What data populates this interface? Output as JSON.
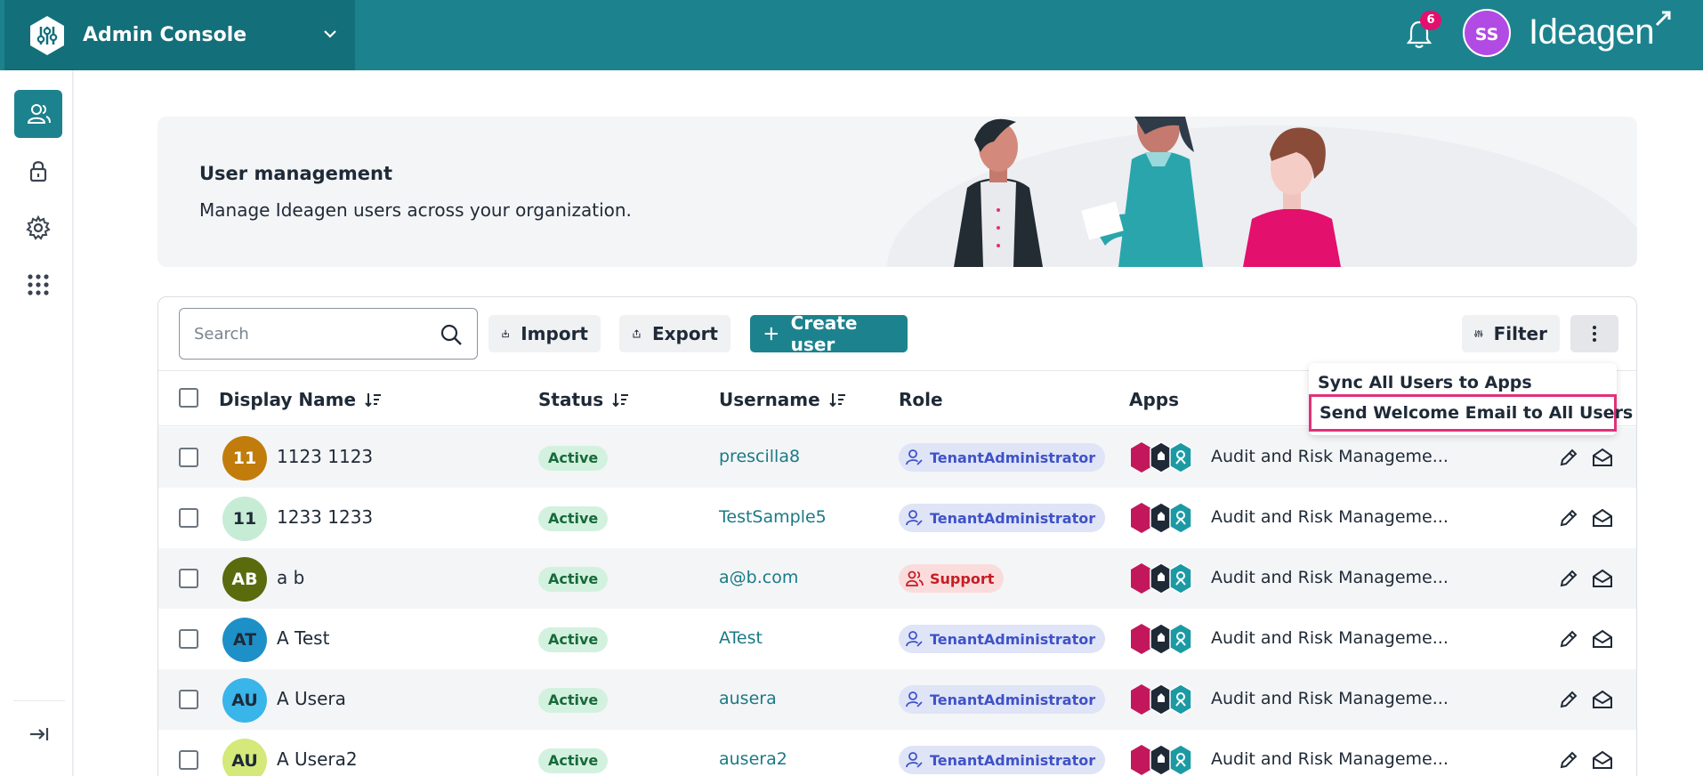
{
  "topbar": {
    "app_title": "Admin Console",
    "notification_count": "6",
    "user_initials": "SS",
    "brand": "Ideagen"
  },
  "sidebar": {
    "items": [
      {
        "name": "users",
        "icon": "users-icon",
        "active": true
      },
      {
        "name": "security",
        "icon": "lock-icon",
        "active": false
      },
      {
        "name": "settings",
        "icon": "gear-icon",
        "active": false
      },
      {
        "name": "apps",
        "icon": "grid-icon",
        "active": false
      }
    ],
    "collapse_icon": "collapse-arrow-icon"
  },
  "hero": {
    "title": "User management",
    "subtitle": "Manage Ideagen users across your organization."
  },
  "toolbar": {
    "search_placeholder": "Search",
    "import_label": "Import",
    "export_label": "Export",
    "create_label": "Create user",
    "filter_label": "Filter"
  },
  "menu": {
    "items": [
      "Sync All Users to Apps",
      "Send Welcome Email to All Users"
    ]
  },
  "table": {
    "columns": [
      "Display Name",
      "Status",
      "Username",
      "Role",
      "Apps"
    ],
    "rows": [
      {
        "initials": "11",
        "avatar_bg": "#c17c0c",
        "avatar_fg": "#ffffff",
        "name": "1123 1123",
        "status": "Active",
        "username": "prescilla8",
        "role": "TenantAdministrator",
        "role_type": "admin",
        "apps": "Audit and Risk Manageme..."
      },
      {
        "initials": "11",
        "avatar_bg": "#c6ecd6",
        "avatar_fg": "#1f2a37",
        "name": "1233 1233",
        "status": "Active",
        "username": "TestSample5",
        "role": "TenantAdministrator",
        "role_type": "admin",
        "apps": "Audit and Risk Manageme..."
      },
      {
        "initials": "AB",
        "avatar_bg": "#596b0d",
        "avatar_fg": "#ffffff",
        "name": "a b",
        "status": "Active",
        "username": "a@b.com",
        "role": "Support",
        "role_type": "support",
        "apps": "Audit and Risk Manageme..."
      },
      {
        "initials": "AT",
        "avatar_bg": "#1e90c8",
        "avatar_fg": "#1f2a37",
        "name": "A Test",
        "status": "Active",
        "username": "ATest",
        "role": "TenantAdministrator",
        "role_type": "admin",
        "apps": "Audit and Risk Manageme..."
      },
      {
        "initials": "AU",
        "avatar_bg": "#39b5ea",
        "avatar_fg": "#1f2a37",
        "name": "A Usera",
        "status": "Active",
        "username": "ausera",
        "role": "TenantAdministrator",
        "role_type": "admin",
        "apps": "Audit and Risk Manageme..."
      },
      {
        "initials": "AU",
        "avatar_bg": "#d4e97a",
        "avatar_fg": "#1f2a37",
        "name": "A Usera2",
        "status": "Active",
        "username": "ausera2",
        "role": "TenantAdministrator",
        "role_type": "admin",
        "apps": "Audit and Risk Manageme..."
      }
    ]
  },
  "colors": {
    "topbar": "#1c838e",
    "topbar_dark": "#136f79",
    "accent": "#1c838e",
    "badge": "#e3106d",
    "avatar_user": "#b24be3",
    "highlight_border": "#e0317a"
  }
}
